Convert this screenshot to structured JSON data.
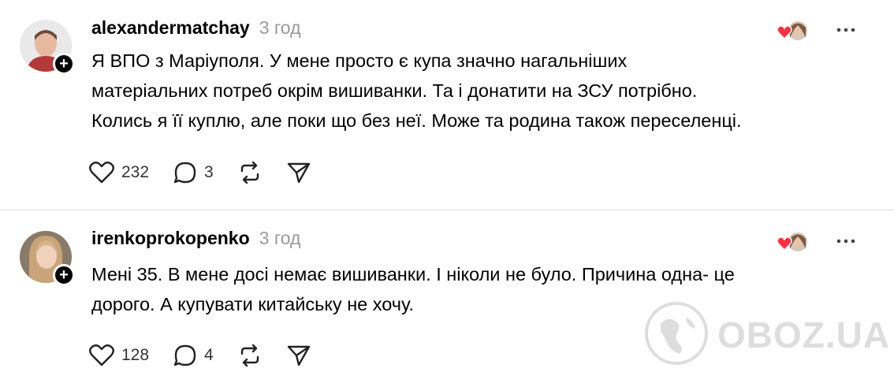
{
  "posts": [
    {
      "username": "alexandermatchay",
      "time": "3 год",
      "text_lines": [
        "Я ВПО з Маріуполя. У мене просто є купа значно нагальніших",
        "матеріальних потреб окрім вишиванки. Та і донатити на ЗСУ потрібно.",
        "Колись я її куплю, але поки що без неї. Може та родина також переселенці."
      ],
      "likes": "232",
      "replies": "3"
    },
    {
      "username": "irenkoprokopenko",
      "time": "3 год",
      "text_lines": [
        "Мені 35. В мене досі немає вишиванки. І ніколи не було. Причина одна- це",
        "дорого. А купувати китайську не хочу."
      ],
      "likes": "128",
      "replies": "4"
    }
  ],
  "follow_symbol": "+",
  "more_symbol": "···",
  "watermark": "OBOZ.UA",
  "icons": [
    "heart-icon",
    "comment-icon",
    "repost-icon",
    "share-icon",
    "more-icon",
    "follow-plus-icon"
  ],
  "colors": {
    "text": "#000000",
    "muted": "#999999",
    "like_red": "#ff3040",
    "divider": "#dcdcdc"
  }
}
